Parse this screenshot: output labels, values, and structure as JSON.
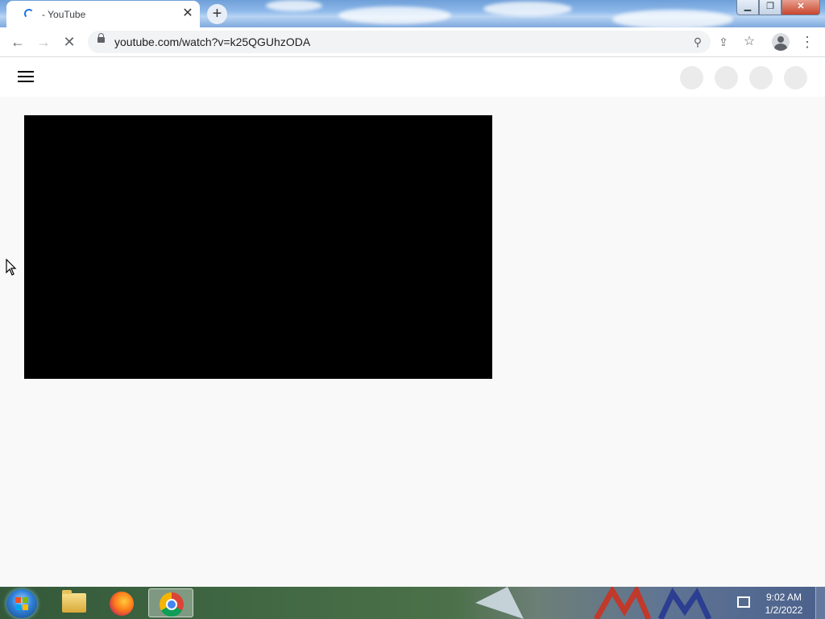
{
  "browser": {
    "tab": {
      "title": "- YouTube",
      "close_glyph": "✕"
    },
    "new_tab_glyph": "+",
    "window_controls": {
      "minimize": "▁",
      "restore": "❐",
      "close": "✕"
    },
    "toolbar": {
      "back_glyph": "←",
      "forward_glyph": "→",
      "stop_glyph": "✕",
      "url": "youtube.com/watch?v=k25QGUhzODA",
      "zoom_glyph": "⚲",
      "share_glyph": "⇪",
      "bookmark_glyph": "☆",
      "menu_glyph": "⋮"
    }
  },
  "page": {
    "header": {
      "menu_icon": "hamburger-icon",
      "placeholder_count": 4
    },
    "video": {
      "state": "loading",
      "color": "#000000"
    }
  },
  "taskbar": {
    "pinned": [
      "file-explorer",
      "firefox",
      "chrome"
    ],
    "active": "chrome",
    "clock": {
      "time": "9:02 AM",
      "date": "1/2/2022"
    }
  }
}
